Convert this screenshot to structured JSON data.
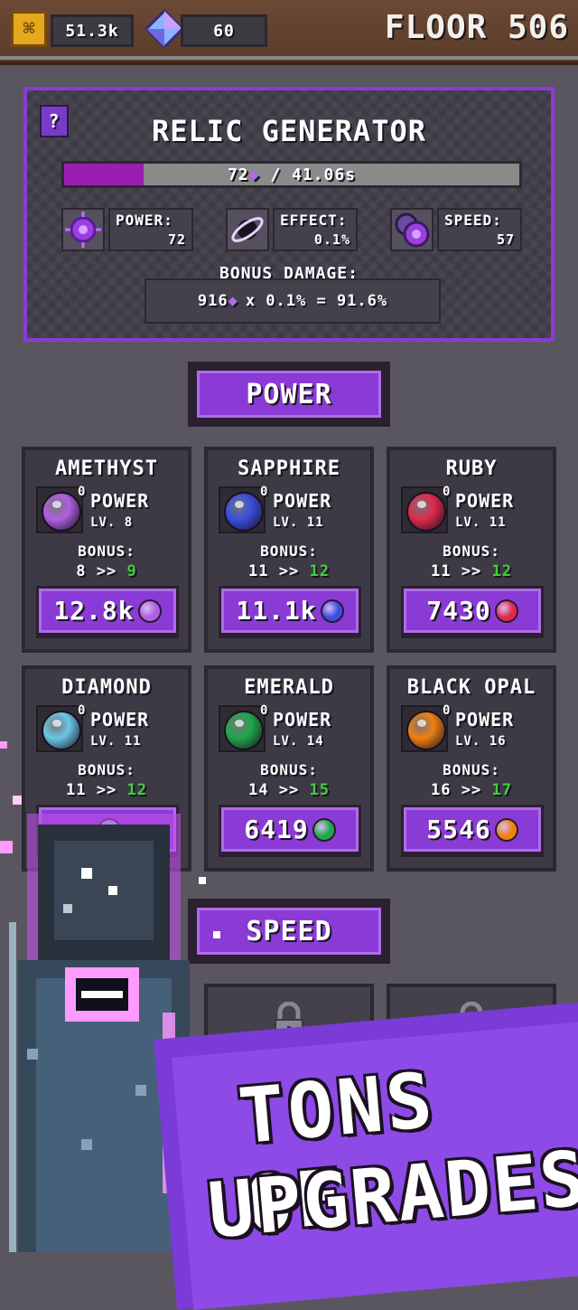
{
  "topbar": {
    "coins": "51.3k",
    "gems": "60",
    "floor_label": "FLOOR 506"
  },
  "relic": {
    "help": "?",
    "title": "RELIC GENERATOR",
    "progress_fraction": 0.175,
    "progress_count": "72",
    "progress_time": "/ 41.06s",
    "stats": [
      {
        "label": "POWER:",
        "value": "72",
        "icon": "sun-relic-icon"
      },
      {
        "label": "EFFECT:",
        "value": "0.1%",
        "icon": "orbit-relic-icon"
      },
      {
        "label": "SPEED:",
        "value": "57",
        "icon": "clock-relic-icon"
      }
    ],
    "bonus_label": "BONUS DAMAGE:",
    "bonus_left": "916",
    "bonus_right": "x 0.1% = 91.6%"
  },
  "sections": {
    "power": "POWER",
    "speed": "SPEED"
  },
  "cards": [
    {
      "name": "AMETHYST",
      "count": "0",
      "type": "POWER",
      "lv": "LV. 8",
      "bonus_label": "BONUS:",
      "bonus_from": "8 >>",
      "bonus_to": "9",
      "price": "12.8k",
      "color": "#b060e0"
    },
    {
      "name": "SAPPHIRE",
      "count": "0",
      "type": "POWER",
      "lv": "LV. 11",
      "bonus_label": "BONUS:",
      "bonus_from": "11 >>",
      "bonus_to": "12",
      "price": "11.1k",
      "color": "#3a4ee0"
    },
    {
      "name": "RUBY",
      "count": "0",
      "type": "POWER",
      "lv": "LV. 11",
      "bonus_label": "BONUS:",
      "bonus_from": "11 >>",
      "bonus_to": "12",
      "price": "7430",
      "color": "#e02a4a"
    },
    {
      "name": "DIAMOND",
      "count": "0",
      "type": "POWER",
      "lv": "LV. 11",
      "bonus_label": "BONUS:",
      "bonus_from": "11 >>",
      "bonus_to": "12",
      "price": "",
      "color": "#6ac8e6"
    },
    {
      "name": "EMERALD",
      "count": "0",
      "type": "POWER",
      "lv": "LV. 14",
      "bonus_label": "BONUS:",
      "bonus_from": "14 >>",
      "bonus_to": "15",
      "price": "6419",
      "color": "#1fa84a"
    },
    {
      "name": "BLACK OPAL",
      "count": "0",
      "type": "POWER",
      "lv": "LV. 16",
      "bonus_label": "BONUS:",
      "bonus_from": "16 >>",
      "bonus_to": "17",
      "price": "5546",
      "color": "#f08010"
    }
  ],
  "promo": {
    "line1": "TONS OF",
    "line2": "UPGRADES!"
  }
}
